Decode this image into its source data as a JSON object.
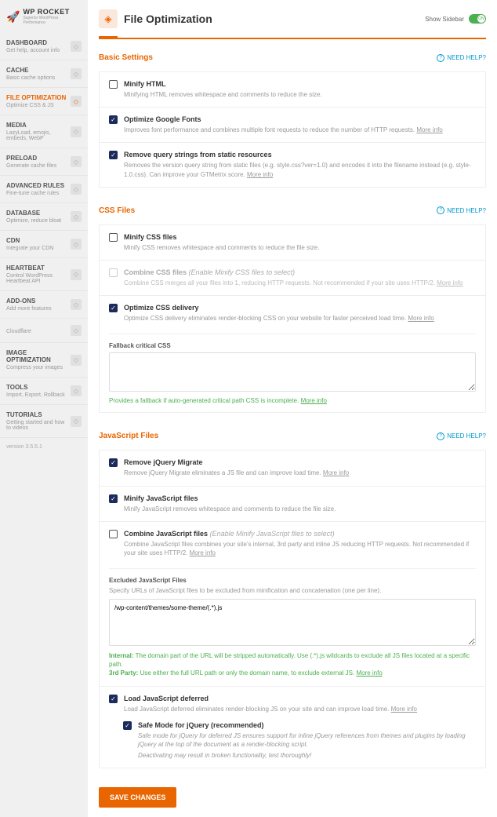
{
  "brand": {
    "name": "WP ROCKET",
    "tagline": "Superior WordPress Performance"
  },
  "version": "version 3.5.5.1",
  "show_sidebar_label": "Show Sidebar",
  "show_sidebar_state": "ON",
  "page": {
    "title": "File Optimization"
  },
  "nav": [
    {
      "title": "DASHBOARD",
      "desc": "Get help, account info"
    },
    {
      "title": "CACHE",
      "desc": "Basic cache options"
    },
    {
      "title": "FILE OPTIMIZATION",
      "desc": "Optimize CSS & JS",
      "active": true
    },
    {
      "title": "MEDIA",
      "desc": "LazyLoad, emojis, embeds, WebP"
    },
    {
      "title": "PRELOAD",
      "desc": "Generate cache files"
    },
    {
      "title": "ADVANCED RULES",
      "desc": "Fine-tune cache rules"
    },
    {
      "title": "DATABASE",
      "desc": "Optimize, reduce bloat"
    },
    {
      "title": "CDN",
      "desc": "Integrate your CDN"
    },
    {
      "title": "HEARTBEAT",
      "desc": "Control WordPress Heartbeat API"
    },
    {
      "title": "ADD-ONS",
      "desc": "Add more features"
    },
    {
      "title": "",
      "desc": "Cloudflare"
    },
    {
      "title": "IMAGE OPTIMIZATION",
      "desc": "Compress your images"
    },
    {
      "title": "TOOLS",
      "desc": "Import, Export, Rollback"
    },
    {
      "title": "TUTORIALS",
      "desc": "Getting started and how to videos"
    }
  ],
  "need_help": "NEED HELP?",
  "more_info": "More info",
  "sections": {
    "basic": {
      "title": "Basic Settings",
      "minify_html": {
        "label": "Minify HTML",
        "desc": "Minifying HTML removes whitespace and comments to reduce the size.",
        "checked": false
      },
      "google_fonts": {
        "label": "Optimize Google Fonts",
        "desc": "Improves font performance and combines multiple font requests to reduce the number of HTTP requests.",
        "checked": true
      },
      "query_strings": {
        "label": "Remove query strings from static resources",
        "desc": "Removes the version query string from static files (e.g. style.css?ver=1.0) and encodes it into the filename instead (e.g. style-1.0.css). Can improve your GTMetrix score.",
        "checked": true
      }
    },
    "css": {
      "title": "CSS Files",
      "minify_css": {
        "label": "Minify CSS files",
        "desc": "Minify CSS removes whitespace and comments to reduce the file size.",
        "checked": false
      },
      "combine_css": {
        "label": "Combine CSS files",
        "hint": "(Enable Minify CSS files to select)",
        "desc": "Combine CSS merges all your files into 1, reducing HTTP requests. Not recommended if your site uses HTTP/2.",
        "checked": false,
        "disabled": true
      },
      "optimize_delivery": {
        "label": "Optimize CSS delivery",
        "desc": "Optimize CSS delivery eliminates render-blocking CSS on your website for faster perceived load time.",
        "checked": true
      },
      "fallback": {
        "label": "Fallback critical CSS",
        "value": "",
        "note_prefix": "Provides a fallback if auto-generated critical path CSS is incomplete."
      }
    },
    "js": {
      "title": "JavaScript Files",
      "remove_migrate": {
        "label": "Remove jQuery Migrate",
        "desc": "Remove jQuery Migrate eliminates a JS file and can improve load time.",
        "checked": true
      },
      "minify_js": {
        "label": "Minify JavaScript files",
        "desc": "Minify JavaScript removes whitespace and comments to reduce the file size.",
        "checked": true
      },
      "combine_js": {
        "label": "Combine JavaScript files",
        "hint": "(Enable Minify JavaScript files to select)",
        "desc": "Combine JavaScript files combines your site's internal, 3rd party and inline JS reducing HTTP requests. Not recommended if your site uses HTTP/2.",
        "checked": false
      },
      "excluded": {
        "label": "Excluded JavaScript Files",
        "desc": "Specify URLs of JavaScript files to be excluded from minification and concatenation (one per line).",
        "value": "/wp-content/themes/some-theme/(.*).js",
        "internal_label": "Internal:",
        "internal_text": " The domain part of the URL will be stripped automatically. Use (.*).js wildcards to exclude all JS files located at a specific path.",
        "third_label": "3rd Party:",
        "third_text": " Use either the full URL path or only the domain name, to exclude external JS."
      },
      "defer": {
        "label": "Load JavaScript deferred",
        "desc": "Load JavaScript deferred eliminates render-blocking JS on your site and can improve load time.",
        "checked": true
      },
      "safe_mode": {
        "label": "Safe Mode for jQuery (recommended)",
        "desc1": "Safe mode for jQuery for deferred JS ensures support for inline jQuery references from themes and plugins by loading jQuery at the top of the document as a render-blocking script.",
        "desc2": "Deactivating may result in broken functionality, test thoroughly!",
        "checked": true
      }
    }
  },
  "save_button": "SAVE CHANGES"
}
